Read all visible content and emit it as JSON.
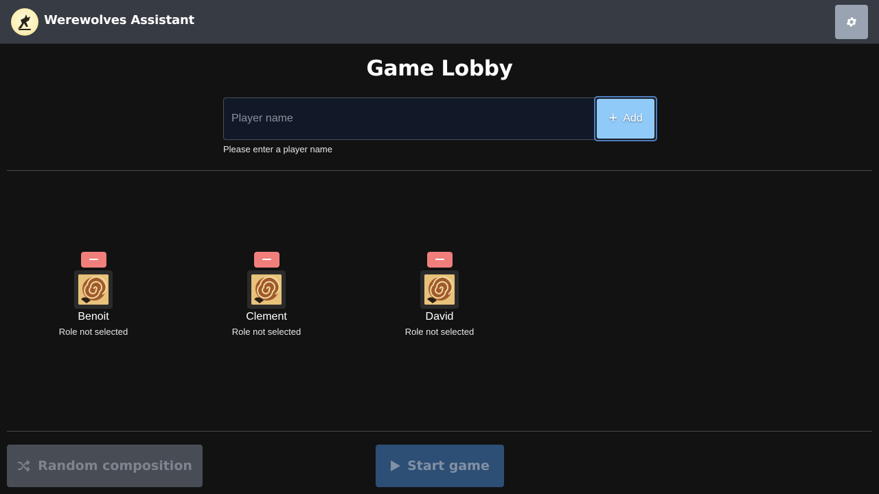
{
  "app": {
    "title": "Werewolves Assistant",
    "logo_icon": "howling-wolf-icon",
    "settings_icon": "gear-icon"
  },
  "lobby": {
    "title": "Game Lobby",
    "name_input": {
      "placeholder": "Player name",
      "value": ""
    },
    "add_button": {
      "label": "Add",
      "icon": "plus-icon"
    },
    "hint": "Please enter a player name"
  },
  "players": [
    {
      "name": "Benoit",
      "role_status": "Role not selected"
    },
    {
      "name": "Clement",
      "role_status": "Role not selected"
    },
    {
      "name": "David",
      "role_status": "Role not selected"
    }
  ],
  "footer": {
    "random_button": {
      "label": "Random composition",
      "icon": "shuffle-icon",
      "disabled": true
    },
    "start_button": {
      "label": "Start game",
      "icon": "play-icon",
      "disabled": true
    }
  },
  "colors": {
    "background": "#121212",
    "topbar": "#373b43",
    "accent": "#90caf9",
    "danger": "#f07f7c"
  }
}
